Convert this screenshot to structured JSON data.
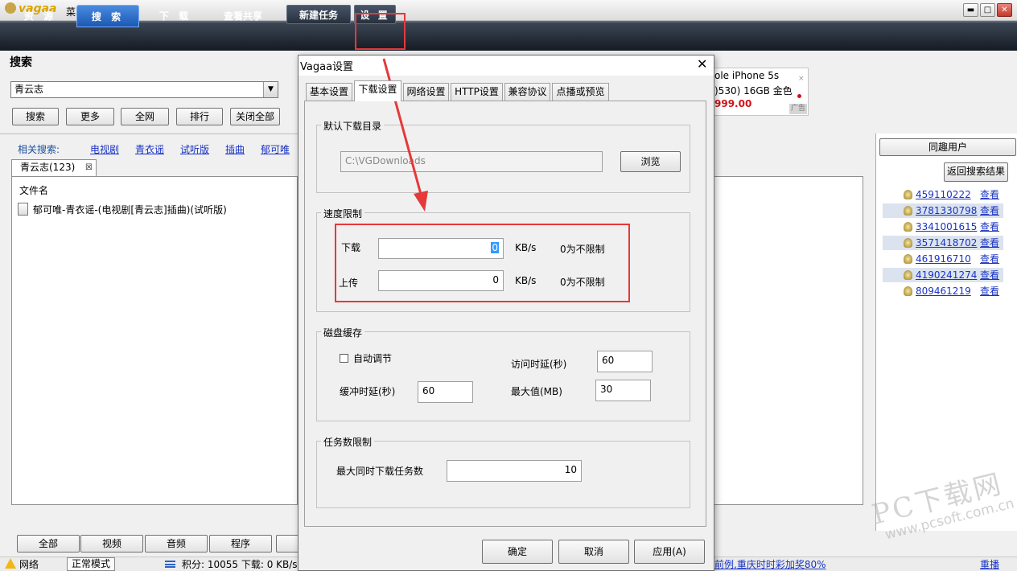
{
  "app": {
    "logo_text": "vagaa",
    "menu_label": "菜单",
    "window_controls": {
      "minimize": "▬",
      "maximize": "□",
      "close": "✕"
    }
  },
  "nav": {
    "tabs": [
      {
        "label": "资 源"
      },
      {
        "label": "搜 索",
        "active": true
      },
      {
        "label": "下 载"
      },
      {
        "label": "查看共享"
      }
    ],
    "new_task_label": "新建任务",
    "settings_label": "设 置"
  },
  "search": {
    "heading": "搜索",
    "query": "青云志",
    "buttons": [
      "搜索",
      "更多",
      "全网",
      "排行",
      "关闭全部"
    ],
    "related_label": "相关搜索:",
    "related_links": [
      "电视剧",
      "青衣谣",
      "试听版",
      "插曲",
      "郁可唯"
    ],
    "result_tab": "青云志(123)",
    "column_filename": "文件名",
    "results": [
      "郁可唯-青衣谣-(电视剧[青云志]插曲)(试听版)"
    ]
  },
  "ad": {
    "line1": "ole iPhone 5s",
    "line2": ")530) 16GB 金色",
    "line3": "999.00",
    "tag": "广告",
    "close": "×"
  },
  "similar_users": {
    "header": "同趣用户",
    "back_button": "返回搜索结果",
    "view_label": "查看",
    "users": [
      "459110222",
      "3781330798",
      "3341001615",
      "3571418702",
      "461916710",
      "4190241274",
      "809461219"
    ]
  },
  "bottom": {
    "filters": [
      "全部",
      "视频",
      "音频",
      "程序"
    ]
  },
  "status": {
    "network": "网络",
    "mode": "正常模式",
    "points": "积分: 10055  下载: 0 KB/s",
    "promo": "前例,重庆时时彩加奖80%",
    "replay": "重播"
  },
  "watermark": {
    "line1": "PC下载网",
    "line2": "www.pcsoft.com.cn"
  },
  "dialog": {
    "title": "Vagaa设置",
    "close": "✕",
    "tabs": [
      "基本设置",
      "下载设置",
      "网络设置",
      "HTTP设置",
      "兼容协议",
      "点播或预览"
    ],
    "active_tab": "下载设置",
    "default_dir": {
      "label": "默认下载目录",
      "path": "C:\\VGDownloads",
      "browse": "浏览"
    },
    "speed": {
      "label": "速度限制",
      "download_label": "下载",
      "download_value": "0",
      "upload_label": "上传",
      "upload_value": "0",
      "unit": "KB/s",
      "hint": "0为不限制"
    },
    "disk_cache": {
      "label": "磁盘缓存",
      "auto_adjust": "自动调节",
      "auto_adjust_checked": false,
      "access_delay_label": "访问时延(秒)",
      "access_delay_value": "60",
      "buffer_delay_label": "缓冲时延(秒)",
      "buffer_delay_value": "60",
      "max_label": "最大值(MB)",
      "max_value": "30"
    },
    "task_limit": {
      "label": "任务数限制",
      "max_tasks_label": "最大同时下载任务数",
      "max_tasks_value": "10"
    },
    "buttons": {
      "ok": "确定",
      "cancel": "取消",
      "apply": "应用(A)"
    }
  },
  "colors": {
    "highlight_red": "#e5393a",
    "nav_active": "#2a6bc6",
    "link_blue": "#1a33c4"
  }
}
